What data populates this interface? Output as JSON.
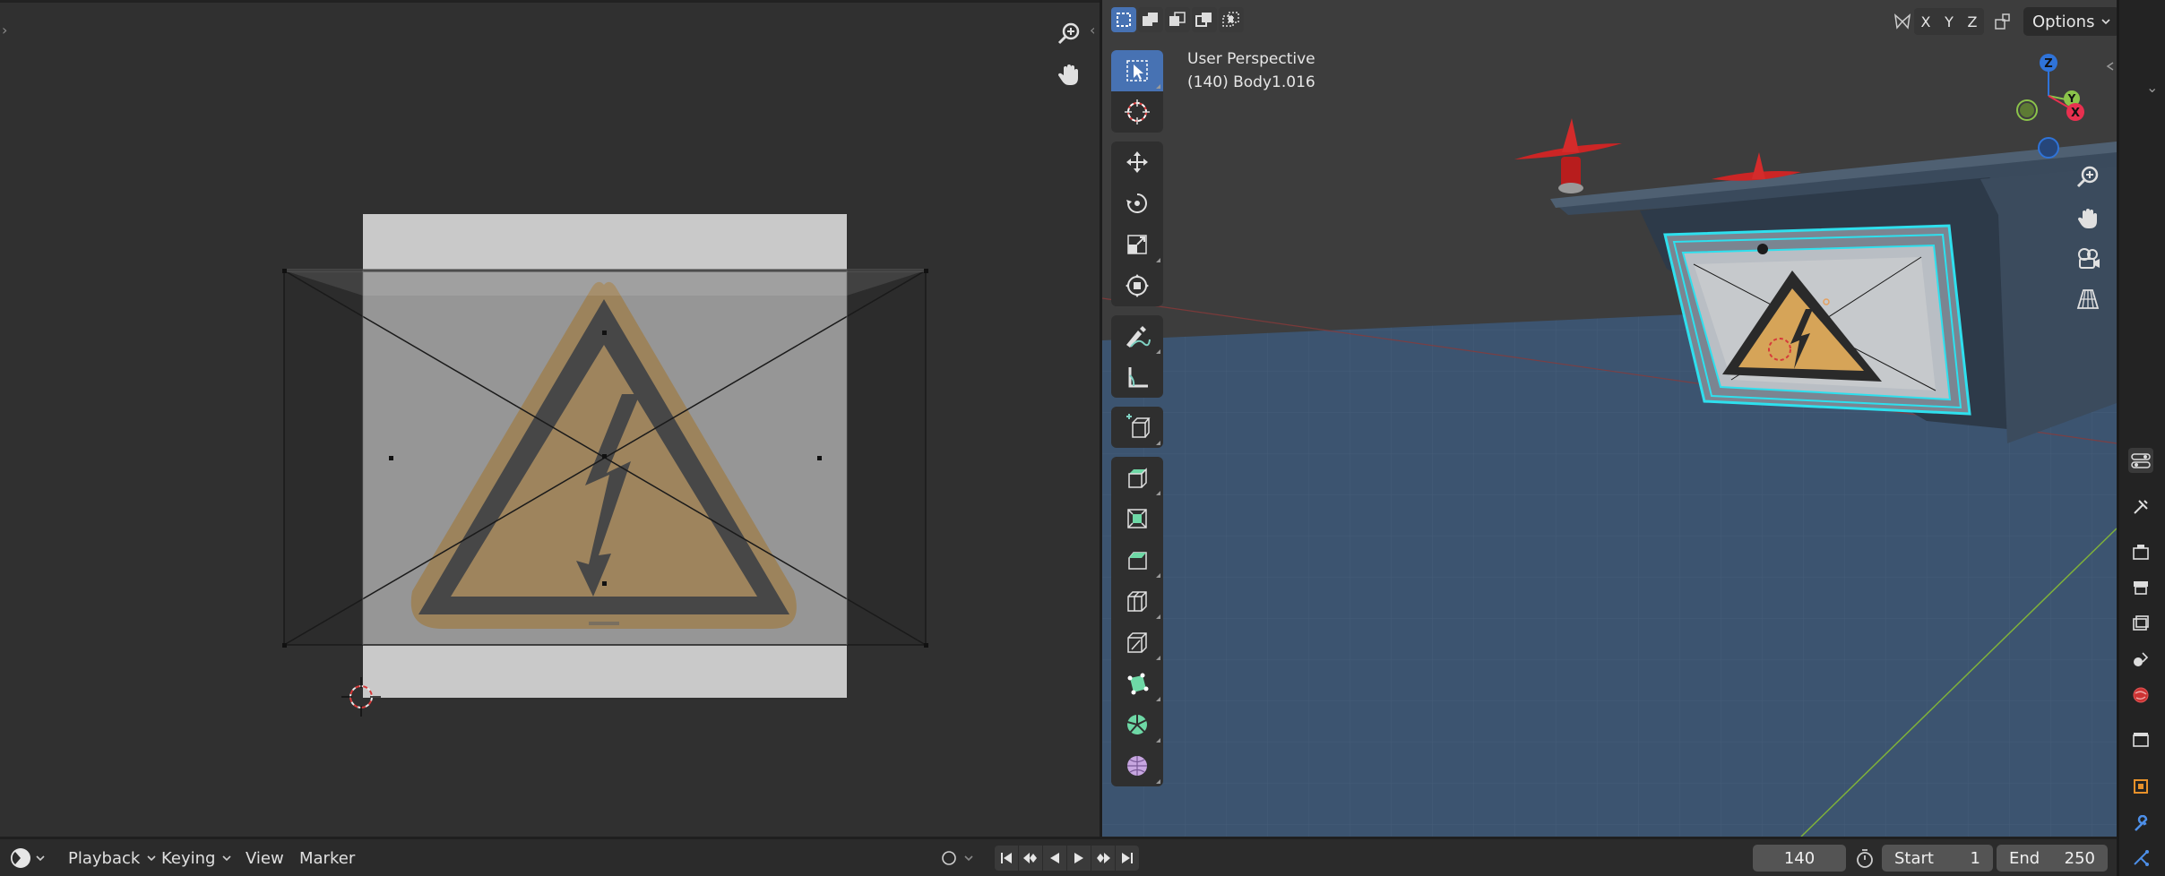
{
  "uv_editor": {
    "nav": {
      "zoom_icon": "zoom-in-icon",
      "pan_icon": "hand-pan-icon"
    }
  },
  "viewport": {
    "view_name": "User Perspective",
    "object_label": "(140) Body1.016",
    "axis_toggles": [
      "X",
      "Y",
      "Z"
    ],
    "options_label": "Options",
    "gizmo_axes": {
      "z": "Z",
      "y": "Y",
      "x": "X"
    },
    "colors": {
      "accent": "#4772b3",
      "x_axis": "#e8304f",
      "y_axis": "#8bc34a",
      "z_axis": "#2f73d8",
      "selection": "#2ee0ee"
    }
  },
  "toolbar": {
    "tools": [
      "select-box-icon",
      "cursor-icon",
      "move-icon",
      "rotate-icon",
      "scale-icon",
      "transform-icon",
      "annotate-icon",
      "measure-icon",
      "add-cube-icon",
      "extrude-icon",
      "inset-icon",
      "bevel-icon",
      "loop-cut-icon",
      "knife-icon",
      "poly-build-icon",
      "spin-icon",
      "smooth-icon"
    ]
  },
  "timeline": {
    "menus": [
      "Playback",
      "Keying",
      "View",
      "Marker"
    ],
    "current_frame": "140",
    "start_label": "Start",
    "start_value": "1",
    "end_label": "End",
    "end_value": "250"
  }
}
